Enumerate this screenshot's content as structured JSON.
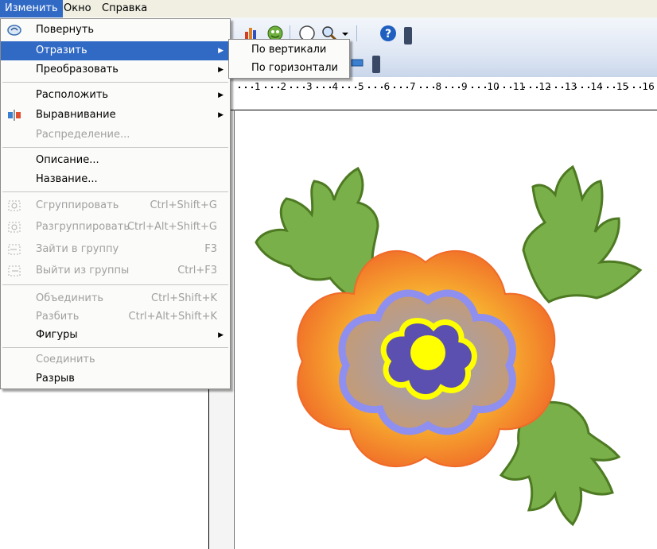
{
  "menubar": {
    "items": [
      "Изменить",
      "Окно",
      "Справка"
    ]
  },
  "menu": {
    "items": [
      {
        "label": "Повернуть",
        "shortcut": "",
        "enabled": true,
        "submenu": false,
        "icon": "rotate-icon"
      },
      {
        "label": "Отразить",
        "shortcut": "",
        "enabled": true,
        "submenu": true,
        "selected": true
      },
      {
        "label": "Преобразовать",
        "shortcut": "",
        "enabled": true,
        "submenu": true
      },
      {
        "label": "Расположить",
        "shortcut": "",
        "enabled": true,
        "submenu": true
      },
      {
        "label": "Выравнивание",
        "shortcut": "",
        "enabled": true,
        "submenu": true,
        "icon": "align-icon"
      },
      {
        "label": "Распределение...",
        "shortcut": "",
        "enabled": false,
        "submenu": false
      },
      {
        "label": "Описание...",
        "shortcut": "",
        "enabled": true,
        "submenu": false
      },
      {
        "label": "Название...",
        "shortcut": "",
        "enabled": true,
        "submenu": false
      },
      {
        "label": "Сгруппировать",
        "shortcut": "Ctrl+Shift+G",
        "enabled": false,
        "submenu": false,
        "icon": "group-icon"
      },
      {
        "label": "Разгруппировать",
        "shortcut": "Ctrl+Alt+Shift+G",
        "enabled": false,
        "submenu": false,
        "icon": "ungroup-icon"
      },
      {
        "label": "Зайти в группу",
        "shortcut": "F3",
        "enabled": false,
        "submenu": false,
        "icon": "enter-group-icon"
      },
      {
        "label": "Выйти из группы",
        "shortcut": "Ctrl+F3",
        "enabled": false,
        "submenu": false,
        "icon": "exit-group-icon"
      },
      {
        "label": "Объединить",
        "shortcut": "Ctrl+Shift+K",
        "enabled": false,
        "submenu": false
      },
      {
        "label": "Разбить",
        "shortcut": "Ctrl+Alt+Shift+K",
        "enabled": false,
        "submenu": false
      },
      {
        "label": "Фигуры",
        "shortcut": "",
        "enabled": true,
        "submenu": true
      },
      {
        "label": "Соединить",
        "shortcut": "",
        "enabled": false,
        "submenu": false
      },
      {
        "label": "Разрыв",
        "shortcut": "",
        "enabled": true,
        "submenu": false
      }
    ]
  },
  "submenu": {
    "items": [
      "По вертикали",
      "По горизонтали"
    ]
  },
  "ruler": {
    "labels": [
      "1",
      "2",
      "3",
      "4",
      "5",
      "6",
      "7",
      "8",
      "9",
      "10",
      "11",
      "12",
      "13",
      "14",
      "15",
      "16"
    ]
  },
  "colors": {
    "selection": "#316ac5",
    "petal_outer": "#f07a30",
    "petal_inner": "#b29a8f",
    "petal_ring": "#8f8ff0",
    "core_petals": "#5b4fb0",
    "core_ring": "#ffff00",
    "center": "#ffff00",
    "leaf": "#7ab04a",
    "leaf_edge": "#4d7a22"
  }
}
